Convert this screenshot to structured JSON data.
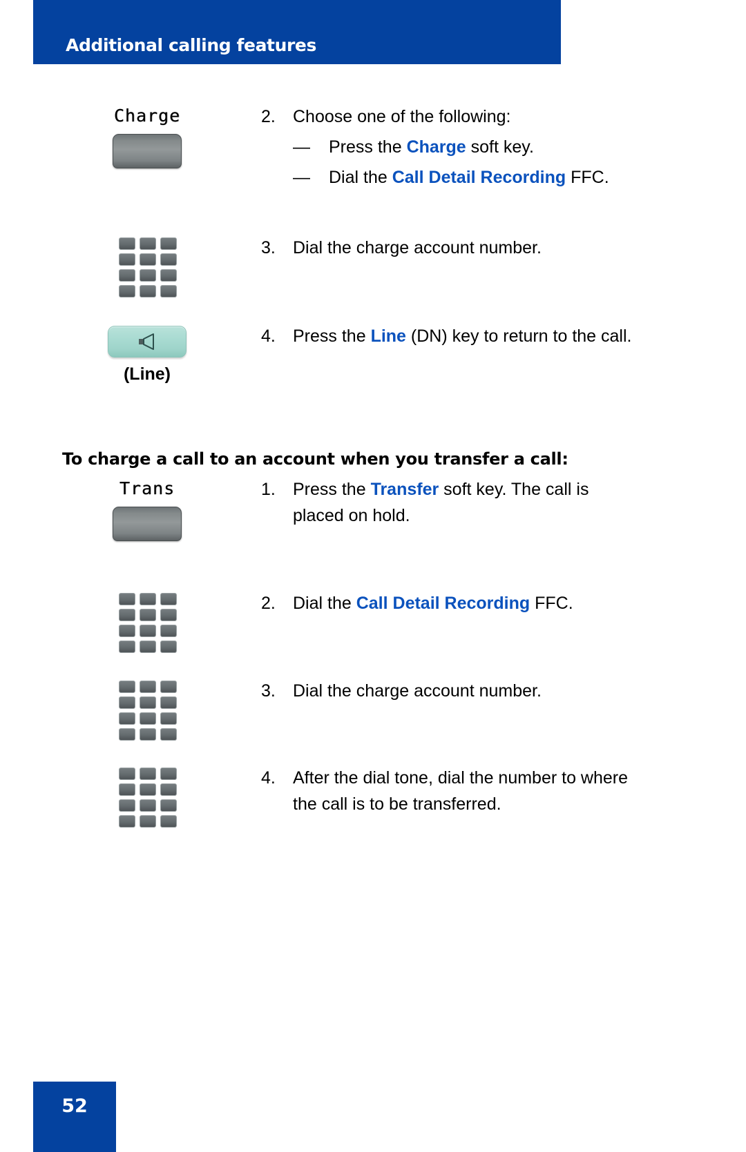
{
  "header": {
    "title": "Additional calling features",
    "background_color": "#04429f",
    "text_color": "#ffffff"
  },
  "accent_color": "#0b52bd",
  "steps_top": [
    {
      "number": "2.",
      "icon": "softkey-charge",
      "softkey_label": "Charge",
      "text": "Choose one of the following:",
      "sub_items": [
        {
          "dash": "—",
          "prefix": "Press the ",
          "highlight": "Charge",
          "suffix": " soft key."
        },
        {
          "dash": "—",
          "prefix": "Dial the ",
          "highlight": "Call Detail Recording",
          "suffix": " FFC."
        }
      ]
    },
    {
      "number": "3.",
      "icon": "keypad",
      "text": "Dial the charge account number."
    },
    {
      "number": "4.",
      "icon": "line-key",
      "icon_caption": "(Line)",
      "prefix": "Press the ",
      "highlight": "Line",
      "suffix": " (DN) key to return to the call."
    }
  ],
  "section_heading": "To charge a call to an account when you transfer a call:",
  "steps_bottom": [
    {
      "number": "1.",
      "icon": "softkey-trans",
      "softkey_label": "Trans",
      "prefix": "Press the ",
      "highlight": "Transfer",
      "suffix": " soft key. The call is placed on hold."
    },
    {
      "number": "2.",
      "icon": "keypad",
      "prefix": "Dial the ",
      "highlight": "Call Detail Recording",
      "suffix": " FFC."
    },
    {
      "number": "3.",
      "icon": "keypad",
      "text": "Dial the charge account number."
    },
    {
      "number": "4.",
      "icon": "keypad",
      "text": "After the dial tone, dial the number to where the call is to be transferred."
    }
  ],
  "footer": {
    "page_number": "52",
    "background_color": "#04429f"
  }
}
